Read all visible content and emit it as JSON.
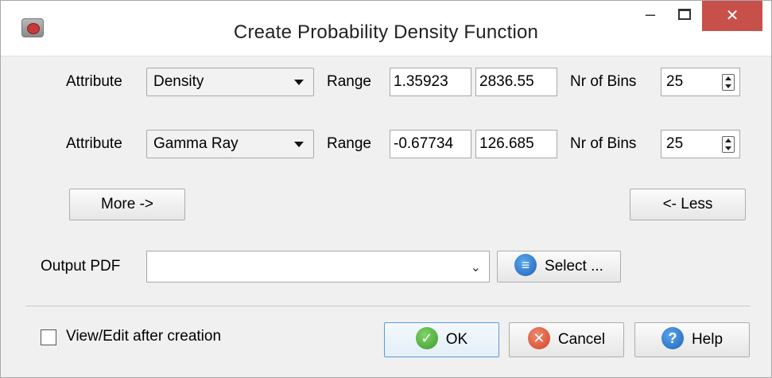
{
  "window": {
    "title": "Create Probability Density Function",
    "minimize": "–",
    "close": "✕"
  },
  "rows": [
    {
      "attribute_label": "Attribute",
      "attribute_value": "Density",
      "range_label": "Range",
      "range_min": "1.35923",
      "range_max": "2836.55",
      "bins_label": "Nr of Bins",
      "bins_value": "25"
    },
    {
      "attribute_label": "Attribute",
      "attribute_value": "Gamma Ray",
      "range_label": "Range",
      "range_min": "-0.67734",
      "range_max": "126.685",
      "bins_label": "Nr of Bins",
      "bins_value": "25"
    }
  ],
  "more_button": "More ->",
  "less_button": "<- Less",
  "output": {
    "label": "Output PDF",
    "value": "",
    "select_button": "Select ..."
  },
  "view_edit_label": "View/Edit after creation",
  "view_edit_checked": false,
  "buttons": {
    "ok": "OK",
    "cancel": "Cancel",
    "help": "Help"
  },
  "icons": {
    "ok": "check-circle-icon",
    "cancel": "x-circle-icon",
    "help": "question-circle-icon",
    "select": "list-icon"
  }
}
